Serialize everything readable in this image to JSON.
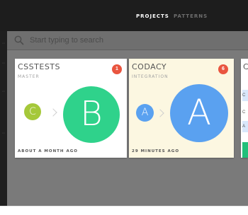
{
  "nav": {
    "projects_label": "PROJECTS",
    "patterns_label": "PATTERNS"
  },
  "search": {
    "placeholder": "Start typing to search"
  },
  "cards": [
    {
      "title": "CSSTESTS",
      "branch": "MASTER",
      "badge": "1",
      "small_letter": "C",
      "big_letter": "B",
      "updated": "ABOUT A MONTH AGO",
      "small_color": "#a5c83a",
      "big_color": "#2fd28b",
      "background": "#ffffff"
    },
    {
      "title": "CODACY",
      "branch": "INTEGRATION",
      "badge": "6",
      "small_letter": "A",
      "big_letter": "A",
      "updated": "29 MINUTES AGO",
      "small_color": "#5aa1f0",
      "big_color": "#5aa1f0",
      "background": "#fcf7e1"
    },
    {
      "title": "C",
      "list_items": [
        "C",
        "C",
        "A"
      ],
      "background": "#ffffff"
    }
  ],
  "colors": {
    "topbar": "#1d1d1d",
    "badge": "#e9553f",
    "accent_green": "#22c07a",
    "list_blue": "#d8e7fb"
  }
}
